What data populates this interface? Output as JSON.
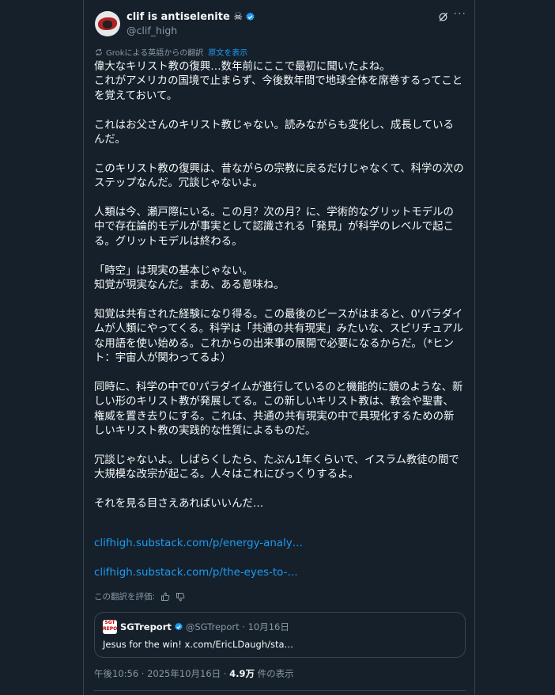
{
  "author": {
    "display_name": "clif is antiselenite ☠",
    "handle": "@clif_high"
  },
  "translation_note": {
    "text": "Grokによる英語からの翻訳",
    "show_original": "原文を表示"
  },
  "post": {
    "body": "偉大なキリスト教の復興…数年前にここで最初に聞いたよね。\nこれがアメリカの国境で止まらず、今後数年間で地球全体を席巻するってことを覚えておいて。\n\nこれはお父さんのキリスト教じゃない。読みながらも変化し、成長しているんだ。\n\nこのキリスト教の復興は、昔ながらの宗教に戻るだけじゃなくて、科学の次のステップなんだ。冗談じゃないよ。\n\n人類は今、瀬戸際にいる。この月？次の月？に、学術的なグリットモデルの中で存在論的モデルが事実として認識される「発見」が科学のレベルで起こる。グリットモデルは終わる。\n\n「時空」は現実の基本じゃない。\n知覚が現実なんだ。まあ、ある意味ね。\n\n知覚は共有された経験になり得る。この最後のピースがはまると、0'パラダイムが人類にやってくる。科学は「共通の共有現実」みたいな、スピリチュアルな用語を使い始める。これからの出来事の展開で必要になるからだ。（*ヒント：宇宙人が関わってるよ）\n\n同時に、科学の中で0'パラダイムが進行しているのと機能的に鏡のような、新しい形のキリスト教が発展してる。この新しいキリスト教は、教会や聖書、権威を置き去りにする。これは、共通の共有現実の中で具現化するための新しいキリスト教の実践的な性質によるものだ。\n\n冗談じゃないよ。しばらくしたら、たぶん1年くらいで、イスラム教徒の間で大規模な改宗が起こる。人々はこれにびっくりするよ。\n\nそれを見る目さえあればいいんだ…",
    "links": [
      "clifhigh.substack.com/p/energy-analy…",
      "clifhigh.substack.com/p/the-eyes-to-…"
    ],
    "rate_label": "この翻訳を評価:"
  },
  "quoted": {
    "avatar_text": "SGT REPORT",
    "name": "SGTreport",
    "handle_date": "@SGTreport · 10月16日",
    "text": "Jesus for the win! x.com/EricLDaugh/sta…"
  },
  "meta": {
    "time_date": "午後10:56 · 2025年10月16日 · ",
    "views": "4.9万",
    "views_label": " 件の表示"
  },
  "colors": {
    "background": "#15202b",
    "accent": "#1d9bf0",
    "border": "#38444d",
    "secondary_text": "#8b98a5"
  }
}
